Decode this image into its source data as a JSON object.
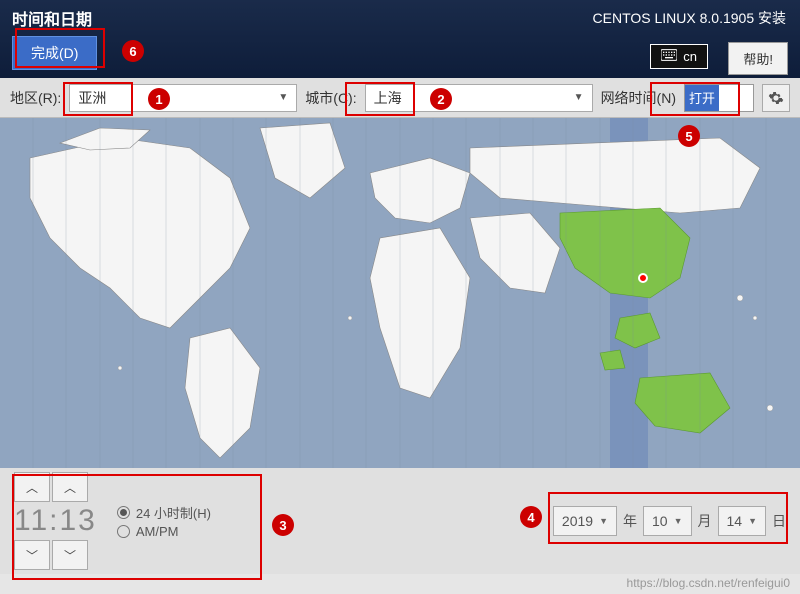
{
  "header": {
    "title": "时间和日期",
    "installer": "CENTOS LINUX 8.0.1905 安装",
    "done": "完成(D)",
    "keyboard": "cn",
    "help": "帮助!"
  },
  "config": {
    "region_label": "地区(R):",
    "region_value": "亚洲",
    "city_label": "城市(C):",
    "city_value": "上海",
    "network_label": "网络时间(N)",
    "toggle_on": "打开"
  },
  "time": {
    "value": "11:13",
    "fmt24": "24 小时制(H)",
    "fmtAMPM": "AM/PM"
  },
  "date": {
    "year": "2019",
    "year_suffix": "年",
    "month": "10",
    "month_suffix": "月",
    "day": "14",
    "day_suffix": "日"
  },
  "annotations": [
    "1",
    "2",
    "3",
    "4",
    "5",
    "6"
  ],
  "watermark": "https://blog.csdn.net/renfeigui0"
}
